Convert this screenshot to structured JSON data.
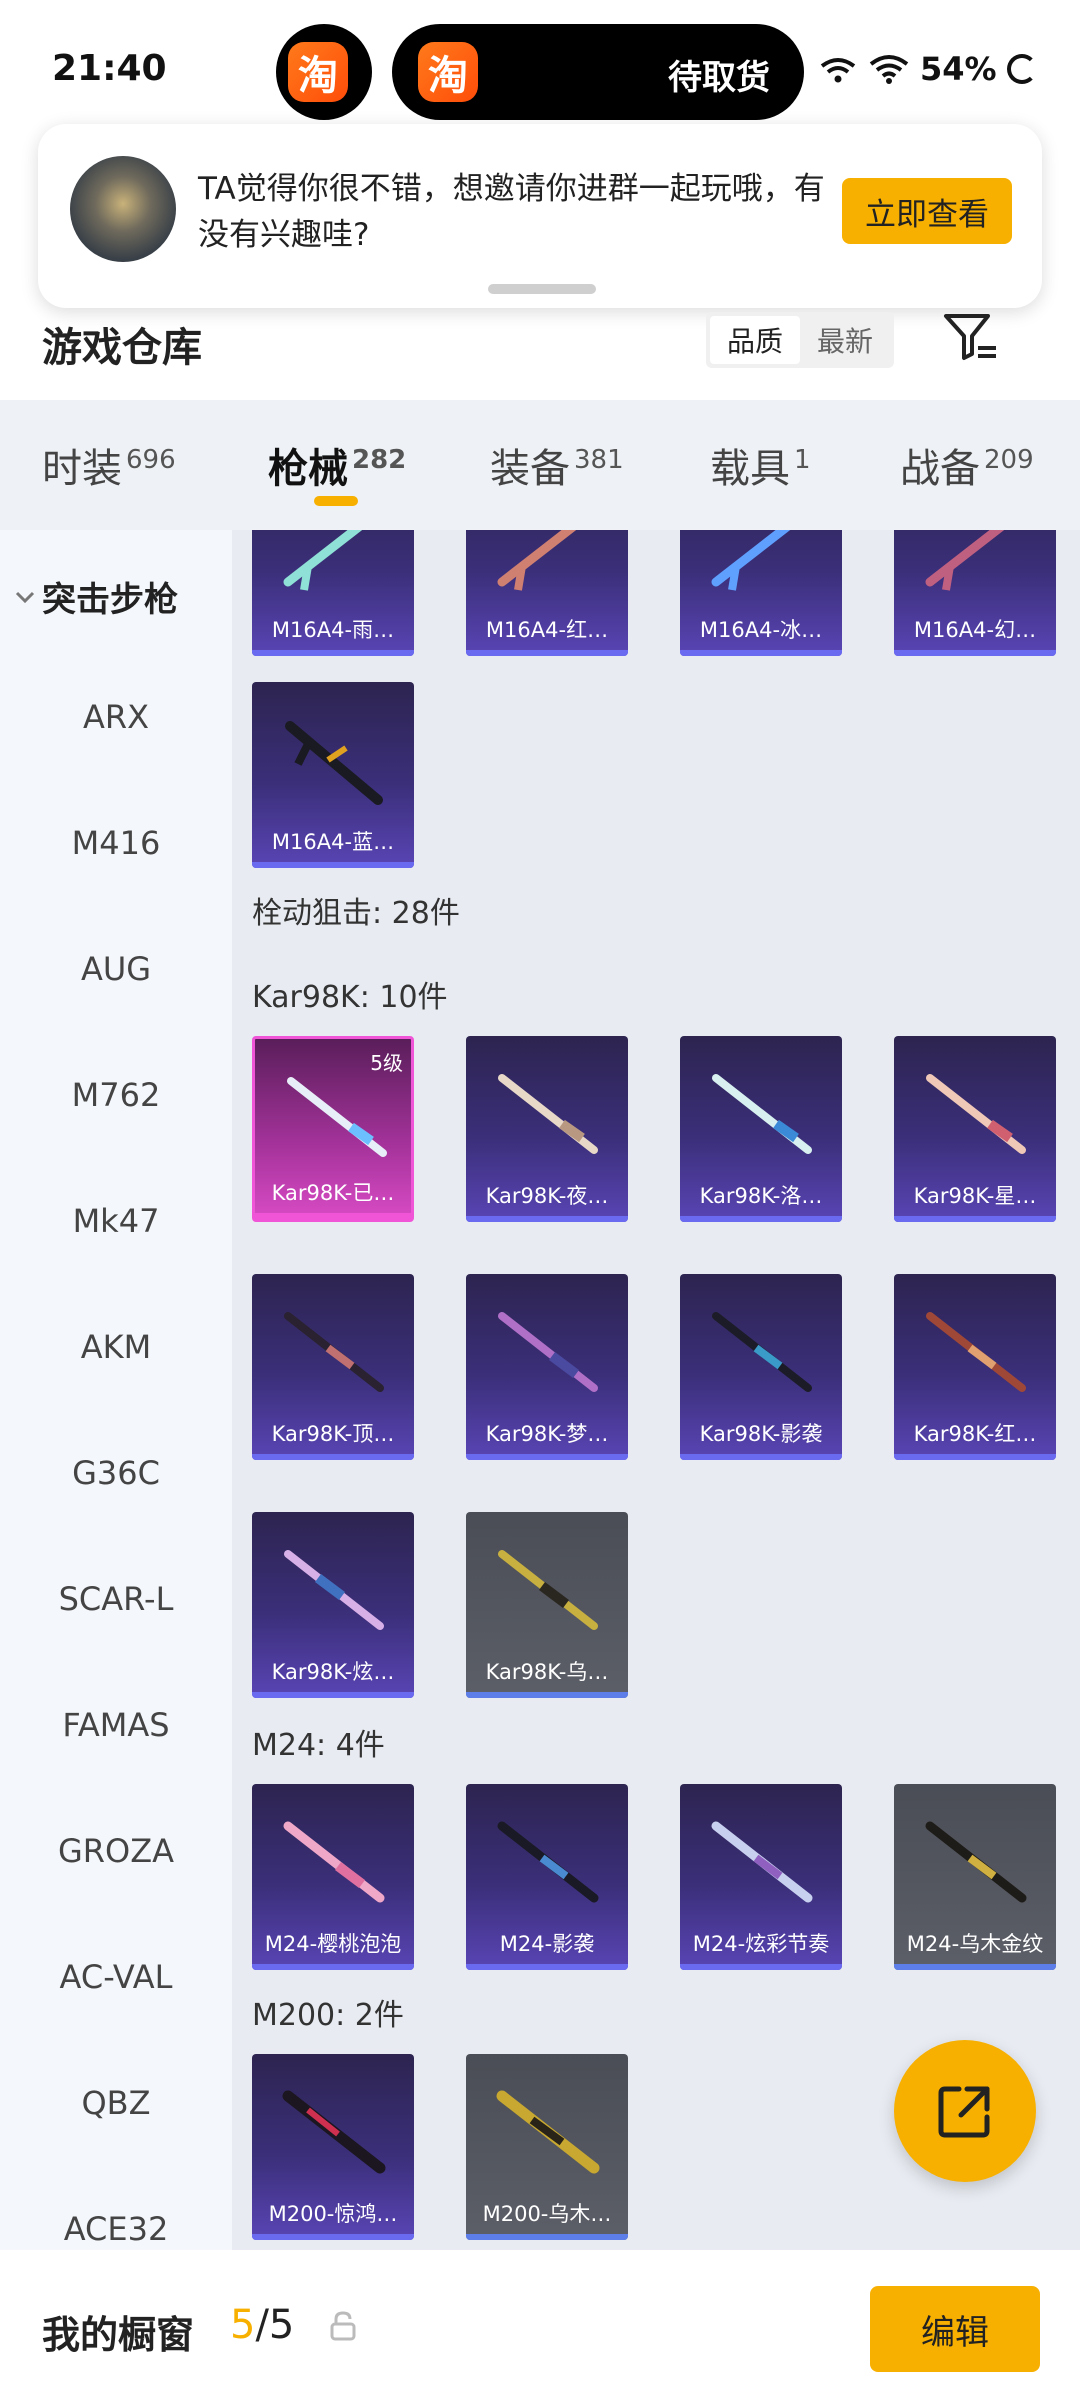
{
  "status_bar": {
    "time": "21:40",
    "app_badge": "淘",
    "live_activity_text": "待取货",
    "battery_percent": "54%"
  },
  "notification": {
    "text": "TA觉得你很不错，想邀请你进群一起玩哦，有没有兴趣哇?",
    "button": "立即查看"
  },
  "header": {
    "title": "游戏仓库",
    "sort_options": [
      "品质",
      "最新"
    ],
    "active_sort": "品质"
  },
  "tabs": [
    {
      "label": "时装",
      "count": "696"
    },
    {
      "label": "枪械",
      "count": "282"
    },
    {
      "label": "装备",
      "count": "381"
    },
    {
      "label": "载具",
      "count": "1"
    },
    {
      "label": "战备",
      "count": "209"
    }
  ],
  "active_tab": "枪械",
  "sidebar": {
    "category": "突击步枪",
    "items": [
      "ARX",
      "M416",
      "AUG",
      "M762",
      "Mk47",
      "AKM",
      "G36C",
      "SCAR-L",
      "FAMAS",
      "GROZA",
      "AC-VAL",
      "QBZ",
      "ACE32"
    ]
  },
  "content": {
    "top_row": [
      "M16A4-雨…",
      "M16A4-红…",
      "M16A4-冰…",
      "M16A4-幻…"
    ],
    "m16_extra": [
      "M16A4-蓝…"
    ],
    "section_sniper": "栓动狙击: 28件",
    "section_kar98k": "Kar98K: 10件",
    "kar98k": [
      {
        "name": "Kar98K-已…",
        "level": "5级"
      },
      {
        "name": "Kar98K-夜…"
      },
      {
        "name": "Kar98K-洛…"
      },
      {
        "name": "Kar98K-星…"
      },
      {
        "name": "Kar98K-顶…"
      },
      {
        "name": "Kar98K-梦…"
      },
      {
        "name": "Kar98K-影袭"
      },
      {
        "name": "Kar98K-红…"
      },
      {
        "name": "Kar98K-炫…"
      },
      {
        "name": "Kar98K-乌…"
      }
    ],
    "section_m24": "M24: 4件",
    "m24": [
      "M24-樱桃泡泡",
      "M24-影袭",
      "M24-炫彩节奏",
      "M24-乌木金纹"
    ],
    "section_m200": "M200: 2件",
    "m200": [
      "M200-惊鸿…",
      "M200-乌木…"
    ]
  },
  "bottom_bar": {
    "title": "我的橱窗",
    "count_current": "5",
    "count_total": "/5",
    "edit_button": "编辑"
  },
  "colors": {
    "accent": "#f7b000",
    "card_purple": "#3b2f7a",
    "card_gray": "#5c5f68",
    "card_pink": "#d84bc4"
  }
}
